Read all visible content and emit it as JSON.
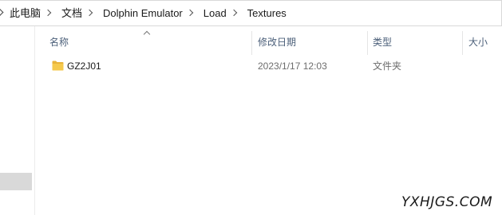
{
  "breadcrumb": {
    "items": [
      "此电脑",
      "文档",
      "Dolphin Emulator",
      "Load",
      "Textures"
    ]
  },
  "columns": {
    "name": "名称",
    "date_modified": "修改日期",
    "type": "类型",
    "size": "大小"
  },
  "sort": {
    "column": "name",
    "direction": "ascending"
  },
  "files": [
    {
      "name": "GZ2J01",
      "date_modified": "2023/1/17 12:03",
      "type": "文件夹",
      "size": "",
      "icon": "folder-icon"
    }
  ],
  "colors": {
    "header_text": "#4c607a",
    "folder_fill": "#f5c94c",
    "folder_tab": "#e8b33a",
    "selection_gray": "#d9d9d9"
  },
  "watermark": "YXHJGS.COM"
}
